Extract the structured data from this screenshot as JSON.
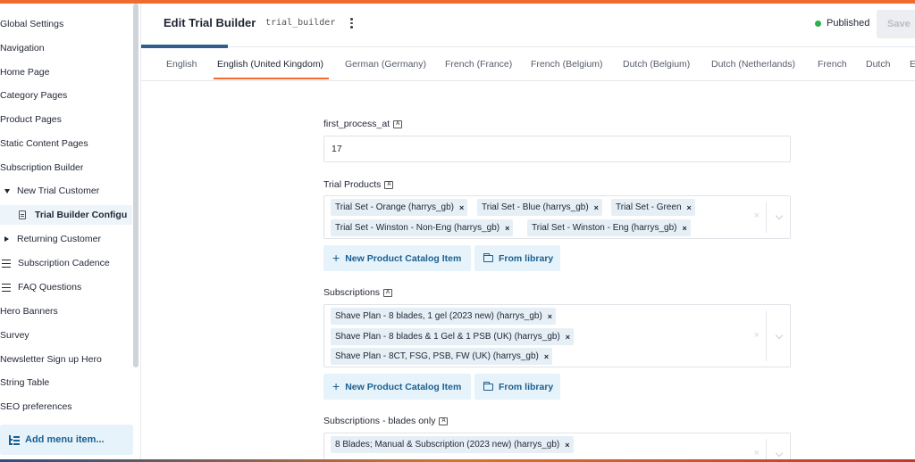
{
  "sidebar": {
    "items": [
      {
        "label": "Global Settings"
      },
      {
        "label": "Navigation"
      },
      {
        "label": "Home Page"
      },
      {
        "label": "Category Pages"
      },
      {
        "label": "Product Pages"
      },
      {
        "label": "Static Content Pages"
      },
      {
        "label": "Subscription Builder"
      },
      {
        "label": "New Trial Customer"
      },
      {
        "label": "Trial Builder Configu"
      },
      {
        "label": "Returning Customer"
      },
      {
        "label": "Subscription Cadence"
      },
      {
        "label": "FAQ Questions"
      },
      {
        "label": "Hero Banners"
      },
      {
        "label": "Survey"
      },
      {
        "label": "Newsletter Sign up Hero"
      },
      {
        "label": "String Table"
      },
      {
        "label": "SEO preferences"
      }
    ],
    "add_menu_label": "Add menu item..."
  },
  "header": {
    "title": "Edit Trial Builder",
    "api_id": "trial_builder",
    "status": "Published",
    "save_label": "Save"
  },
  "tabs": [
    {
      "label": "English"
    },
    {
      "label": "English (United Kingdom)"
    },
    {
      "label": "German (Germany)"
    },
    {
      "label": "French (France)"
    },
    {
      "label": "French (Belgium)"
    },
    {
      "label": "Dutch (Belgium)"
    },
    {
      "label": "Dutch (Netherlands)"
    },
    {
      "label": "French"
    },
    {
      "label": "Dutch"
    },
    {
      "label": "E"
    }
  ],
  "form": {
    "first_process_at": {
      "label": "first_process_at",
      "value": "17"
    },
    "trial_products": {
      "label": "Trial Products",
      "chips": [
        "Trial Set - Orange (harrys_gb)",
        "Trial Set - Blue (harrys_gb)",
        "Trial Set - Green",
        "Trial Set - Winston - Non-Eng (harrys_gb)",
        "Trial Set - Winston - Eng (harrys_gb)"
      ]
    },
    "subscriptions": {
      "label": "Subscriptions",
      "chips": [
        "Shave Plan - 8 blades, 1 gel (2023 new) (harrys_gb)",
        "Shave Plan - 8 blades & 1 Gel & 1 PSB (UK) (harrys_gb)",
        "Shave Plan - 8CT, FSG, PSB, FW (UK) (harrys_gb)"
      ]
    },
    "subscriptions_blades_only": {
      "label": "Subscriptions - blades only",
      "chips": [
        "8 Blades; Manual & Subscription (2023 new) (harrys_gb)"
      ]
    },
    "new_item_label": "New Product Catalog Item",
    "from_library_label": "From library",
    "remove_glyph": "×",
    "clear_glyph": "×"
  }
}
